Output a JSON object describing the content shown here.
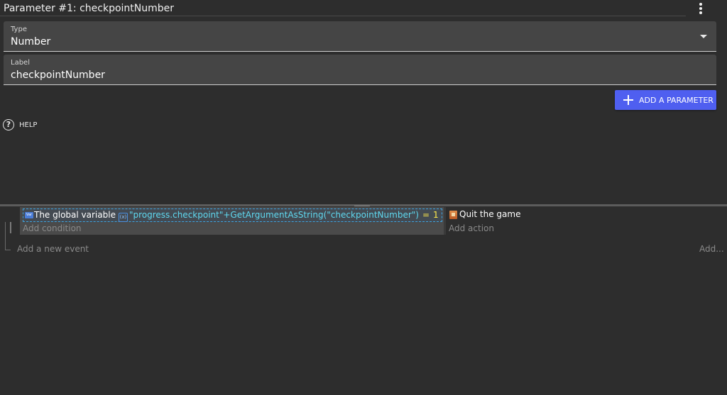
{
  "parameter": {
    "title": "Parameter #1: checkpointNumber",
    "type_label": "Type",
    "type_value": "Number",
    "label_label": "Label",
    "label_value": "checkpointNumber",
    "more_icon": "more-vertical-icon"
  },
  "add_parameter_button": "ADD A PARAMETER",
  "help": {
    "label": "HELP",
    "icon": "help-circle-icon"
  },
  "event": {
    "condition": {
      "prefix": "The global variable",
      "expression": "\"progress.checkpoint\"+GetArgumentAsString(\"checkpointNumber\")",
      "operator": "=",
      "value": "1"
    },
    "add_condition": "Add condition",
    "action": {
      "text": "Quit the game"
    },
    "add_action": "Add action"
  },
  "add_event": "Add a new event",
  "add_more": "Add...",
  "colors": {
    "accent": "#4f5ff0",
    "background": "#2d2d2d",
    "expression": "#5fd9f0",
    "operator": "#ffe94a"
  }
}
